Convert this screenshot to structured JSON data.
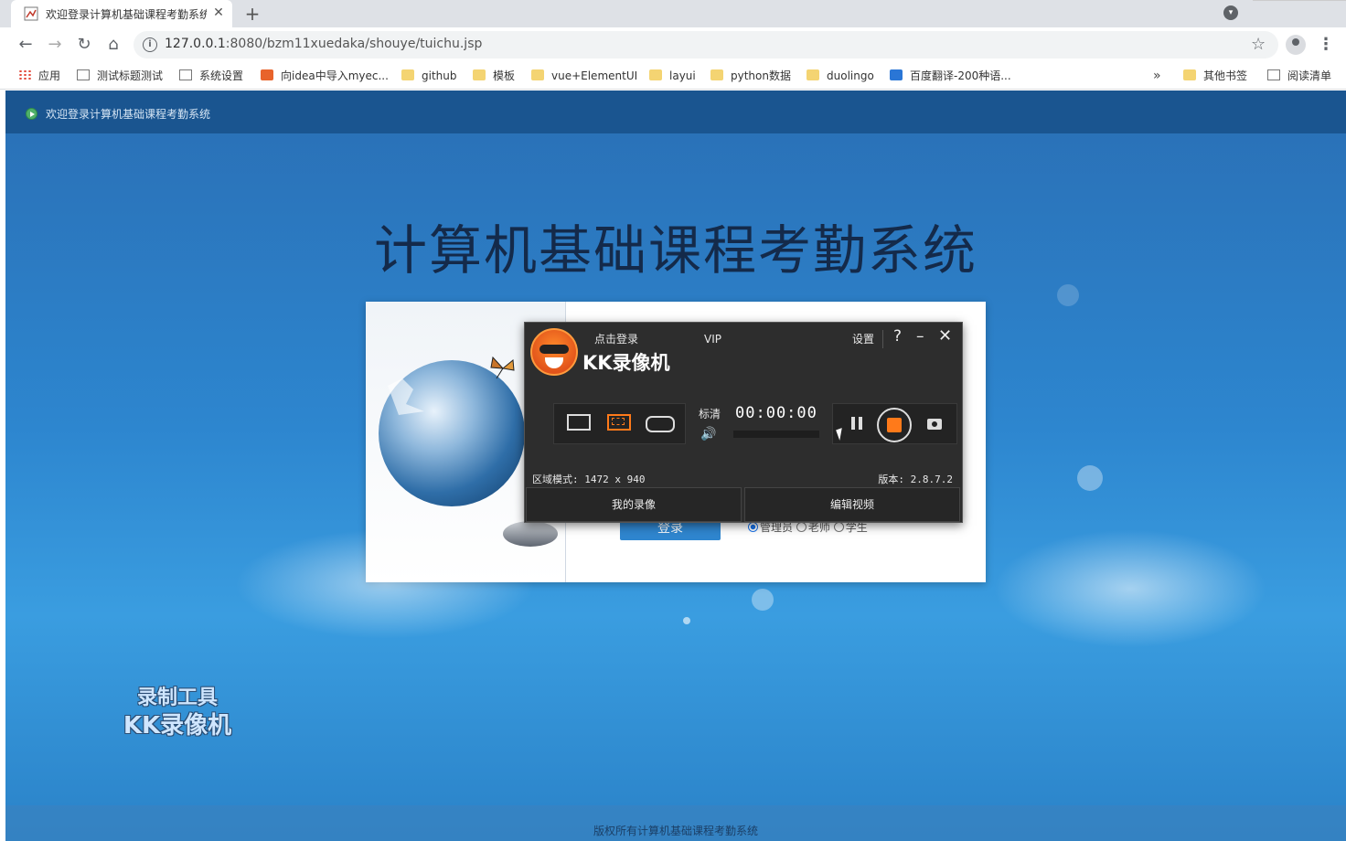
{
  "browser": {
    "tab": {
      "title": "欢迎登录计算机基础课程考勤系统",
      "close": "✕"
    },
    "new_tab": "+",
    "nav": {
      "back": "←",
      "forward": "→",
      "reload": "↻",
      "home": "⌂"
    },
    "url": {
      "host": "127.0.0.1",
      "rest": ":8080/bzm11xuedaka/shouye/tuichu.jsp"
    },
    "star": "☆",
    "menu": "⋮",
    "tab_search": "▾",
    "bookmarks": [
      {
        "label": "应用",
        "icon": "apps-icon"
      },
      {
        "label": "测试标题测试",
        "icon": "page-icon"
      },
      {
        "label": "系统设置",
        "icon": "page-icon"
      },
      {
        "label": "向idea中导入myec...",
        "icon": "orange-c-icon"
      },
      {
        "label": "github",
        "icon": "folder-icon"
      },
      {
        "label": "模板",
        "icon": "folder-icon"
      },
      {
        "label": "vue+ElementUI",
        "icon": "folder-icon"
      },
      {
        "label": "layui",
        "icon": "folder-icon"
      },
      {
        "label": "python数据",
        "icon": "folder-icon"
      },
      {
        "label": "duolingo",
        "icon": "folder-icon"
      },
      {
        "label": "百度翻译-200种语...",
        "icon": "translate-icon"
      }
    ],
    "bookmarks_more": "»",
    "other_bookmarks": "其他书签",
    "reading_list": "阅读清单"
  },
  "page": {
    "top_welcome": "欢迎登录计算机基础课程考勤系统",
    "system_title": "计算机基础课程考勤系统",
    "login_button": "登录",
    "roles": [
      {
        "label": "管理员",
        "selected": true
      },
      {
        "label": "老师",
        "selected": false
      },
      {
        "label": "学生",
        "selected": false
      }
    ],
    "footer": "版权所有计算机基础课程考勤系统",
    "watermark": {
      "line1": "录制工具",
      "line2": "KK录像机"
    }
  },
  "recorder": {
    "brand": "KK录像机",
    "login": "点击登录",
    "vip": "VIP",
    "settings": "设置",
    "help": "?",
    "minimize": "–",
    "close": "✕",
    "quality": "标清",
    "timer": "00:00:00",
    "speaker": "🔊",
    "area_mode": "区域模式: 1472 x 940",
    "version": "版本: 2.8.7.2",
    "my_recordings": "我的录像",
    "edit_video": "编辑视频"
  }
}
